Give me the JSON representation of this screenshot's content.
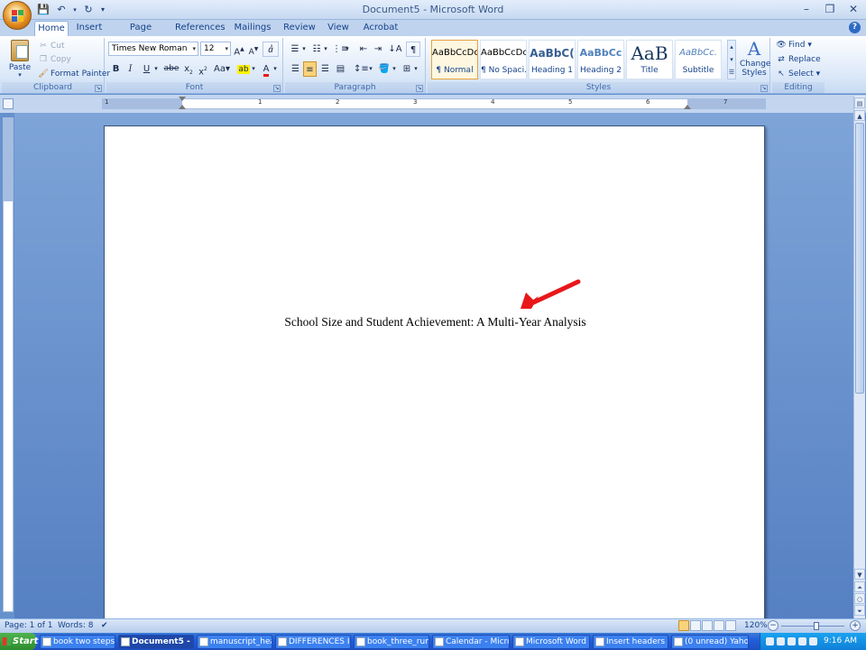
{
  "window": {
    "title": "Document5 - Microsoft Word"
  },
  "tabs": [
    "Home",
    "Insert",
    "Page Layout",
    "References",
    "Mailings",
    "Review",
    "View",
    "Acrobat"
  ],
  "clipboard": {
    "paste": "Paste",
    "cut": "Cut",
    "copy": "Copy",
    "format_painter": "Format Painter",
    "label": "Clipboard"
  },
  "font": {
    "family": "Times New Roman",
    "size": "12",
    "label": "Font"
  },
  "paragraph": {
    "label": "Paragraph"
  },
  "styles": {
    "items": [
      {
        "sample": "AaBbCcDc",
        "name": "¶ Normal"
      },
      {
        "sample": "AaBbCcDc",
        "name": "¶ No Spaci..."
      },
      {
        "sample": "AaBbC(",
        "name": "Heading 1"
      },
      {
        "sample": "AaBbCc",
        "name": "Heading 2"
      },
      {
        "sample": "AaB",
        "name": "Title"
      },
      {
        "sample": "AaBbCc.",
        "name": "Subtitle"
      }
    ],
    "change_styles": "Change Styles",
    "label": "Styles"
  },
  "editing": {
    "find": "Find",
    "replace": "Replace",
    "select": "Select",
    "label": "Editing"
  },
  "ruler": {
    "numbers": [
      "1",
      "1",
      "2",
      "3",
      "4",
      "5",
      "6",
      "7"
    ]
  },
  "document": {
    "title_line": "School Size and Student Achievement: A Multi-Year Analysis"
  },
  "status": {
    "page": "Page: 1 of 1",
    "words": "Words: 8",
    "zoom": "120%"
  },
  "taskbar": {
    "start": "Start",
    "items": [
      "book two steps...",
      "Document5 - ...",
      "manuscript_hea...",
      "DIFFERENCES I...",
      "book_three_run...",
      "Calendar - Micro...",
      "Microsoft Word ...",
      "Insert headers ...",
      "(0 unread) Yaho..."
    ],
    "clock": "9:16 AM"
  },
  "colors": {
    "arrow": "#e8171a",
    "ribbon_text": "#15428b"
  }
}
